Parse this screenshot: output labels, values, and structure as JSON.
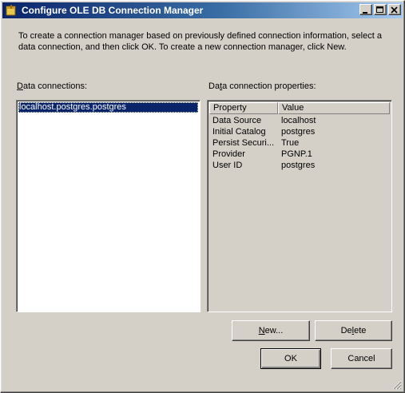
{
  "window": {
    "title": "Configure OLE DB Connection Manager",
    "icon": "package-icon",
    "controls": [
      "minimize-icon",
      "maximize-icon",
      "close-icon"
    ]
  },
  "intro_text": "To create a connection manager based on previously defined connection information, select a data connection, and then click OK. To create a new connection manager, click New.",
  "data_connections": {
    "label_prefix": "",
    "label_accel": "D",
    "label_rest": "ata connections:",
    "items": [
      "localhost.postgres.postgres"
    ],
    "selected_index": 0
  },
  "properties": {
    "label_prefix": "Da",
    "label_accel": "t",
    "label_rest": "a connection properties:",
    "columns": [
      "Property",
      "Value"
    ],
    "rows": [
      {
        "property": "Data Source",
        "value": "localhost"
      },
      {
        "property": "Initial Catalog",
        "value": "postgres"
      },
      {
        "property": "Persist Securi...",
        "value": "True"
      },
      {
        "property": "Provider",
        "value": "PGNP.1"
      },
      {
        "property": "User ID",
        "value": "postgres"
      }
    ]
  },
  "buttons": {
    "new_accel": "N",
    "new_rest": "ew...",
    "delete_prefix": "De",
    "delete_accel": "l",
    "delete_rest": "ete",
    "ok": "OK",
    "cancel": "Cancel"
  },
  "colors": {
    "selection": "#0a246a",
    "face": "#d4d0c8",
    "title_start": "#0a246a",
    "title_end": "#a6caf0"
  }
}
